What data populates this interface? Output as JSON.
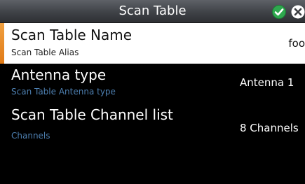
{
  "header": {
    "title": "Scan Table"
  },
  "icons": {
    "confirm": "check-icon",
    "close": "close-icon",
    "confirm_color": "#2fa84f",
    "accent_color": "#e88a26"
  },
  "rows": [
    {
      "label": "Scan Table Name",
      "sublabel": "Scan Table Alias",
      "value": "foo",
      "selected": true
    },
    {
      "label": "Antenna type",
      "sublabel": "Scan Table Antenna type",
      "value": "Antenna 1",
      "selected": false
    },
    {
      "label": "Scan Table Channel list",
      "sublabel": "Channels",
      "value": "8 Channels",
      "selected": false
    }
  ]
}
